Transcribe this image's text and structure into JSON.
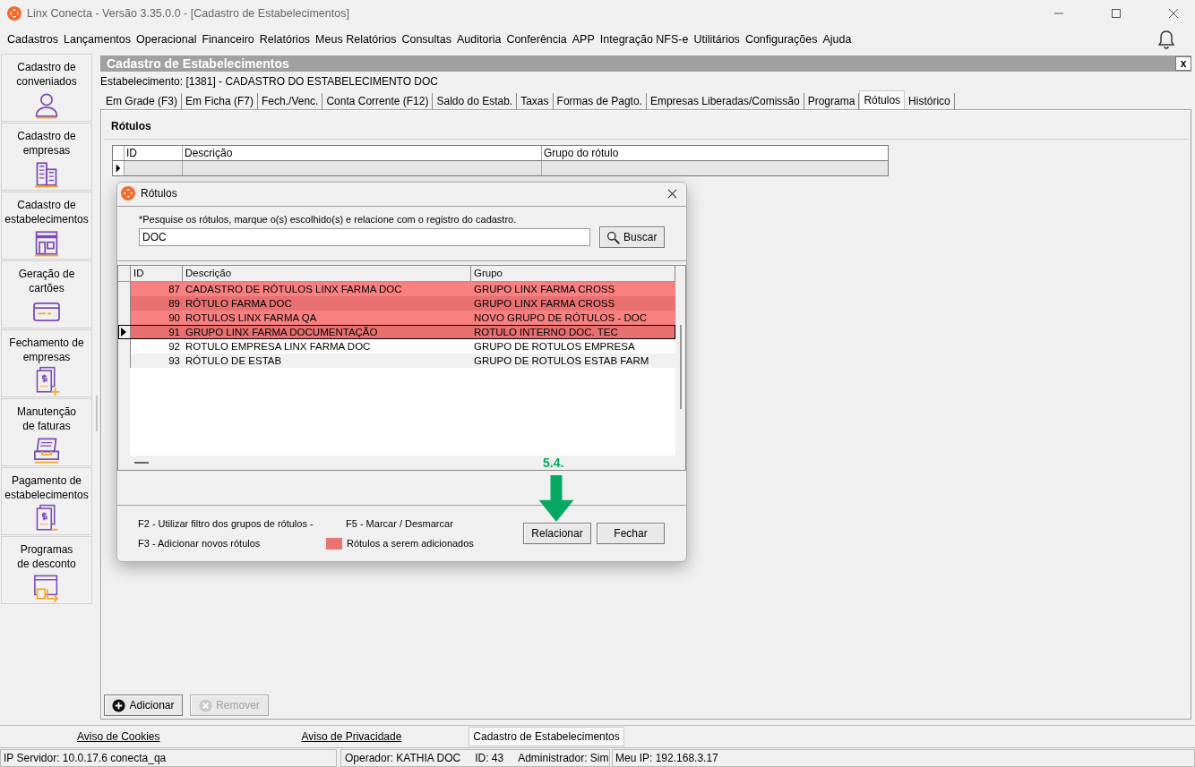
{
  "window": {
    "title": "Linx Conecta - Versão 3.35.0.0 - [Cadastro de Estabelecimentos]"
  },
  "menu": [
    "Cadastros",
    "Lançamentos",
    "Operacional",
    "Financeiro",
    "Relatórios",
    "Meus Relatórios",
    "Consultas",
    "Auditoria",
    "Conferência",
    "APP",
    "Integração NFS-e",
    "Utilitários",
    "Configurações",
    "Ajuda"
  ],
  "sidebar": {
    "items": [
      {
        "lines": [
          "Cadastro de",
          "conveniados"
        ],
        "kind": "person"
      },
      {
        "lines": [
          "Cadastro de",
          "empresas"
        ],
        "kind": "buildings"
      },
      {
        "lines": [
          "Cadastro de",
          "estabelecimentos"
        ],
        "kind": "store"
      },
      {
        "lines": [
          "Geração de",
          "cartões"
        ],
        "kind": "card"
      },
      {
        "lines": [
          "Fechamento de",
          "empresas"
        ],
        "kind": "invoice-plus"
      },
      {
        "lines": [
          "Manutenção",
          "de faturas"
        ],
        "kind": "tray"
      },
      {
        "lines": [
          "Pagamento de",
          "estabelecimentos"
        ],
        "kind": "invoice-minus"
      },
      {
        "lines": [
          "Programas",
          "de desconto"
        ],
        "kind": "window-arrow"
      }
    ]
  },
  "form": {
    "title": "Cadastro de Estabelecimentos",
    "close": "x",
    "establishment": "Estabelecimento: [1381] - CADASTRO DO ESTABELECIMENTO DOC",
    "tabs": [
      {
        "label": "Em Grade (F3)",
        "selected": false
      },
      {
        "label": "Em Ficha (F7)",
        "selected": false
      },
      {
        "label": "Fech./Venc.",
        "selected": false
      },
      {
        "label": "Conta Corrente (F12)",
        "selected": false
      },
      {
        "label": "Saldo do Estab.",
        "selected": false
      },
      {
        "label": "Taxas",
        "selected": false
      },
      {
        "label": "Formas de Pagto.",
        "selected": false
      },
      {
        "label": "Empresas Liberadas/Comissão",
        "selected": false
      },
      {
        "label": "Programa",
        "selected": false
      },
      {
        "label": "Rótulos",
        "selected": true
      },
      {
        "label": "Histórico",
        "selected": false
      }
    ],
    "section_title": "Rótulos",
    "grid": {
      "columns": [
        "ID",
        "Descrição",
        "Grupo do rótulo"
      ]
    },
    "buttons": [
      {
        "label": "Adicionar",
        "disabled": false,
        "kind": "add"
      },
      {
        "label": "Remover",
        "disabled": true,
        "kind": "remove"
      }
    ]
  },
  "dialog": {
    "title": "Rótulos",
    "instruction": "*Pesquise os rótulos, marque o(s) escolhido(s) e relacione com o registro do cadastro.",
    "search": {
      "value": "DOC"
    },
    "search_button": "Buscar",
    "table": {
      "columns": [
        "ID",
        "Descrição",
        "Grupo"
      ],
      "rows": [
        {
          "id": "87",
          "description": "CADASTRO DE RÓTULOS LINX FARMA DOC",
          "group": "GRUPO LINX  FARMA CROSS",
          "marked": true,
          "current": false
        },
        {
          "id": "89",
          "description": "RÓTULO FARMA DOC",
          "group": "GRUPO LINX  FARMA CROSS",
          "marked": true,
          "current": false
        },
        {
          "id": "90",
          "description": "ROTULOS LINX FARMA QA",
          "group": "NOVO GRUPO DE RÓTULOS - DOC",
          "marked": true,
          "current": false
        },
        {
          "id": "91",
          "description": "GRUPO LINX FARMA DOCUMENTAÇÃO",
          "group": "ROTULO INTERNO DOC. TEC",
          "marked": true,
          "current": true
        },
        {
          "id": "92",
          "description": "ROTULO EMPRESA LINX FARMA DOC",
          "group": "GRUPO DE ROTULOS EMPRESA",
          "marked": false,
          "current": false
        },
        {
          "id": "93",
          "description": "RÓTULO DE ESTAB",
          "group": "GRUPO DE ROTULOS ESTAB FARM",
          "marked": false,
          "current": false
        }
      ]
    },
    "shortcuts": [
      "F2 - Utilizar filtro dos grupos de rótulos",
      "-",
      "F5 - Marcar / Desmarcar",
      "F3 - Adicionar novos rótulos"
    ],
    "legend": {
      "label": "Rótulos a serem adicionados",
      "color": "#e87474"
    },
    "buttons": [
      "Relacionar",
      "Fechar"
    ],
    "annotation": "5.4."
  },
  "footer_tabs": [
    {
      "label": "Aviso de Cookies",
      "kind": "link"
    },
    {
      "label": "Aviso de Privacidade",
      "kind": "link"
    },
    {
      "label": "Cadastro de Estabelecimentos",
      "kind": "tab"
    }
  ],
  "status_bar": {
    "server": "IP Servidor: 10.0.17.6 conecta_qa",
    "operator": "Operador: KATHIA DOC",
    "id": "ID: 43",
    "admin": "Administrador: Sim",
    "ip": "Meu IP: 192.168.3.17"
  }
}
